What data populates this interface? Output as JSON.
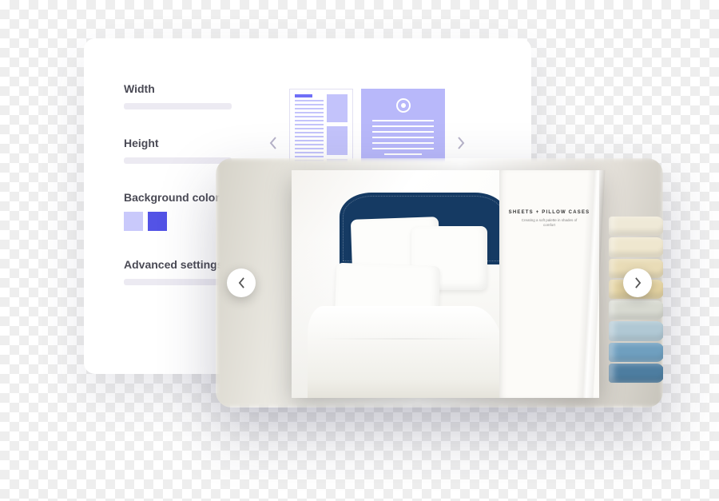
{
  "settings": {
    "width": {
      "label": "Width"
    },
    "height": {
      "label": "Height"
    },
    "bgcolor": {
      "label": "Background color"
    },
    "advanced": {
      "label": "Advanced settings"
    },
    "swatches": {
      "light": "#c9c9fb",
      "dark": "#5353e6"
    }
  },
  "catalog": {
    "page_title": "Sheets + Pillow Cases",
    "page_subtitle": "Creating a soft palette in shades of comfort"
  },
  "towel_colors": [
    "#efe9d7",
    "#efe7cf",
    "#e9dcb7",
    "#e4d3a2",
    "#d7d9d0",
    "#b0c8d4",
    "#6f9fbf",
    "#4d7da0"
  ]
}
